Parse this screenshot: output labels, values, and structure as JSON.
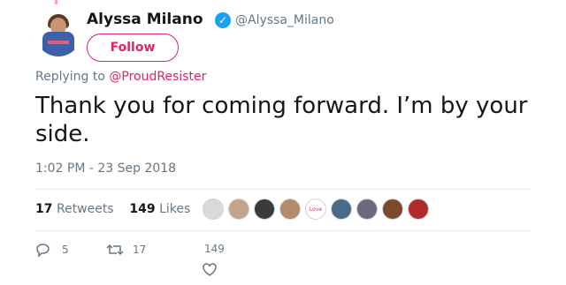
{
  "user": {
    "name": "Alyssa Milano",
    "handle": "@Alyssa_Milano",
    "follow_label": "Follow"
  },
  "reply": {
    "prefix": "Replying to",
    "mention": "@ProudResister"
  },
  "tweet": {
    "text": "Thank you for coming forward. I’m by your side.",
    "timestamp": "1:02 PM - 23 Sep 2018"
  },
  "stats": {
    "retweets_count": "17",
    "retweets_label": "Retweets",
    "likes_count": "149",
    "likes_label": "Likes"
  },
  "likers": [
    {
      "color": "#d9d9d9"
    },
    {
      "color": "#c4a58a"
    },
    {
      "color": "#3a3a3a"
    },
    {
      "color": "#b58a6a"
    },
    {
      "color": "#ffffff",
      "text": "Love"
    },
    {
      "color": "#4a6a8a"
    },
    {
      "color": "#6a6a7a"
    },
    {
      "color": "#7a4a2a"
    },
    {
      "color": "#b02a2a"
    }
  ],
  "actions": {
    "reply_count": "5",
    "retweet_count": "17",
    "like_count": "149"
  },
  "colors": {
    "accent": "#e0245e",
    "verified": "#1da1f2",
    "muted": "#657786"
  },
  "icons": [
    "verified-badge-icon",
    "reply-icon",
    "retweet-icon",
    "heart-icon"
  ]
}
